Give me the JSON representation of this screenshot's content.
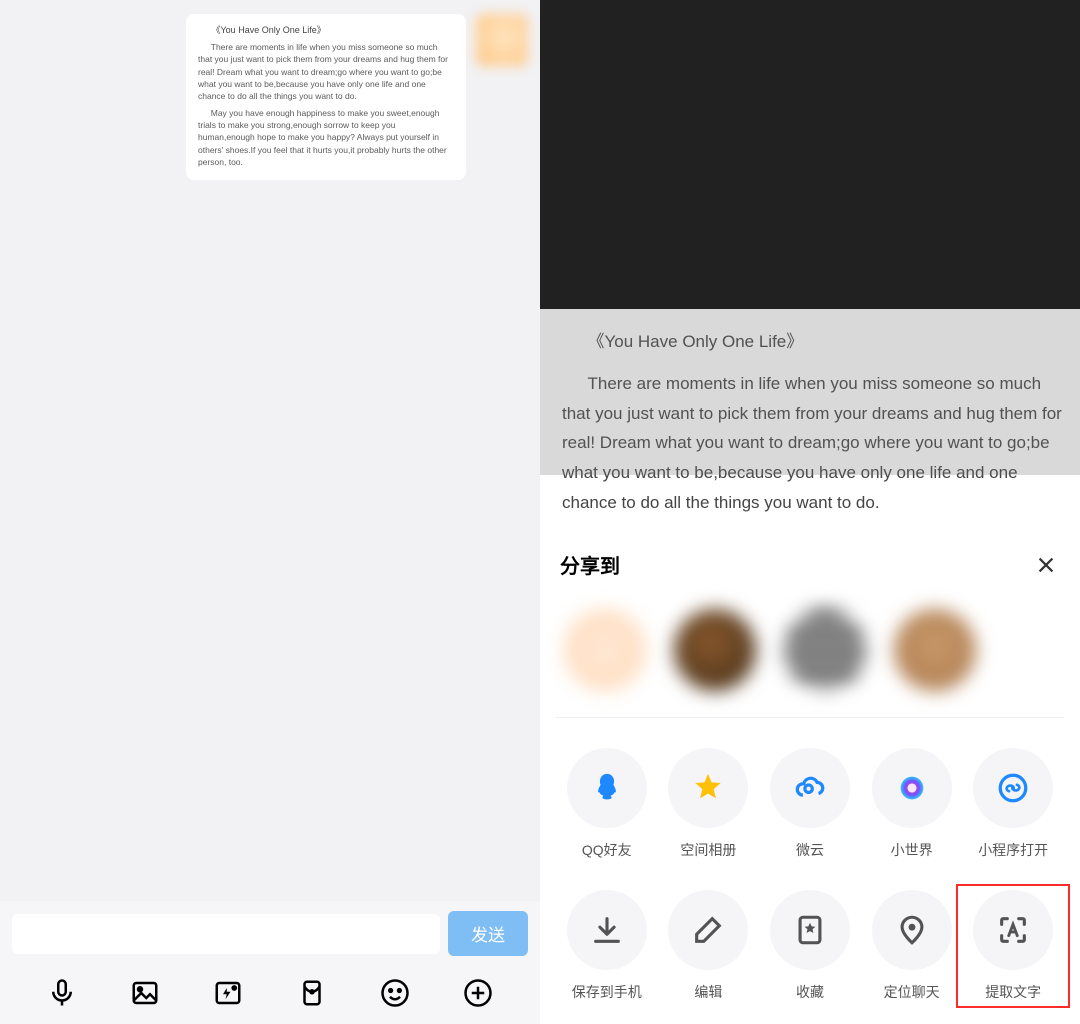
{
  "chat": {
    "message": {
      "title": "《You Have Only One Life》",
      "para1": "There are moments in life when you miss someone so much that you just want to pick them from your dreams and hug them for real! Dream what you want to dream;go where you want to go;be what you want to be,because you have only one life and one chance to do all the things you want to do.",
      "para2": "May you have enough happiness to make you sweet,enough trials to make you strong,enough sorrow to keep you human,enough hope to make you happy? Always put yourself in others' shoes.If you feel that it hurts you,it probably hurts the other person, too."
    },
    "send_label": "发送",
    "toolbar_icons": [
      "voice-icon",
      "photo-icon",
      "camera-icon",
      "redpacket-icon",
      "emoji-icon",
      "plus-icon"
    ]
  },
  "viewer": {
    "title": "《You Have Only One Life》",
    "para1": "There are moments in life when you miss someone so much that you just want to pick them from your dreams and hug them for real! Dream what you want to dream;go where you want to go;be what you want to be,because you have only one life and one chance to do all the things you want to do.",
    "para2": "May you have enough happiness to make you sweet,enough trials to make you strong,enough sorrow to keep you human,enough hope to make you happy? Always put yourself in others' shoes.If you feel that it hurts you,it probably hurts the other person, too."
  },
  "share_sheet": {
    "title": "分享到",
    "actions_row1": [
      {
        "id": "qq-friends",
        "label": "QQ好友"
      },
      {
        "id": "qzone-album",
        "label": "空间相册"
      },
      {
        "id": "weiyun",
        "label": "微云"
      },
      {
        "id": "small-world",
        "label": "小世界"
      },
      {
        "id": "miniprogram",
        "label": "小程序打开"
      }
    ],
    "actions_row2": [
      {
        "id": "save-to-phone",
        "label": "保存到手机"
      },
      {
        "id": "edit",
        "label": "编辑"
      },
      {
        "id": "favorite",
        "label": "收藏"
      },
      {
        "id": "locate-chat",
        "label": "定位聊天"
      },
      {
        "id": "extract-text",
        "label": "提取文字"
      }
    ],
    "highlighted_action": "extract-text"
  }
}
